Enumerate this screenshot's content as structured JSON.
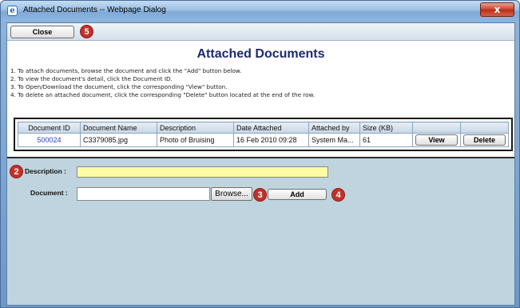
{
  "window": {
    "title": "Attached Documents -- Webpage Dialog",
    "app_icon_glyph": "e",
    "close_glyph": "x"
  },
  "toolbar": {
    "close_label": "Close",
    "badge_close": "5"
  },
  "page": {
    "title": "Attached Documents",
    "instructions": [
      "1. To attach documents, browse the document and click the \"Add\" button below.",
      "2. To view the document's detail, click the Document ID.",
      "3. To Open/Download the document, click the corresponding \"View\" button.",
      "4. To delete an attached document, click the corresponding \"Delete\" button located at the end of the row."
    ]
  },
  "table": {
    "headers": [
      "Document ID",
      "Document Name",
      "Description",
      "Date Attached",
      "Attached by",
      "Size (KB)",
      "",
      ""
    ],
    "rows": [
      {
        "document_id": "500024",
        "document_name": "C3379085.jpg",
        "description": "Photo of Bruising",
        "date_attached": "16 Feb 2010 09:28",
        "attached_by": "System Ma...",
        "size_kb": "61",
        "view_label": "View",
        "delete_label": "Delete"
      }
    ]
  },
  "form": {
    "description_label": "Description :",
    "description_value": "",
    "document_label": "Document :",
    "document_value": "",
    "browse_label": "Browse...",
    "add_label": "Add",
    "badge_description": "2",
    "badge_browse": "3",
    "badge_add": "4"
  },
  "colors": {
    "title_blue": "#1c2a6d",
    "link_blue": "#2a3fbf",
    "badge_red": "#c3302a",
    "description_field_yellow": "#fdfca4",
    "form_panel_bg": "#bfd4de"
  }
}
